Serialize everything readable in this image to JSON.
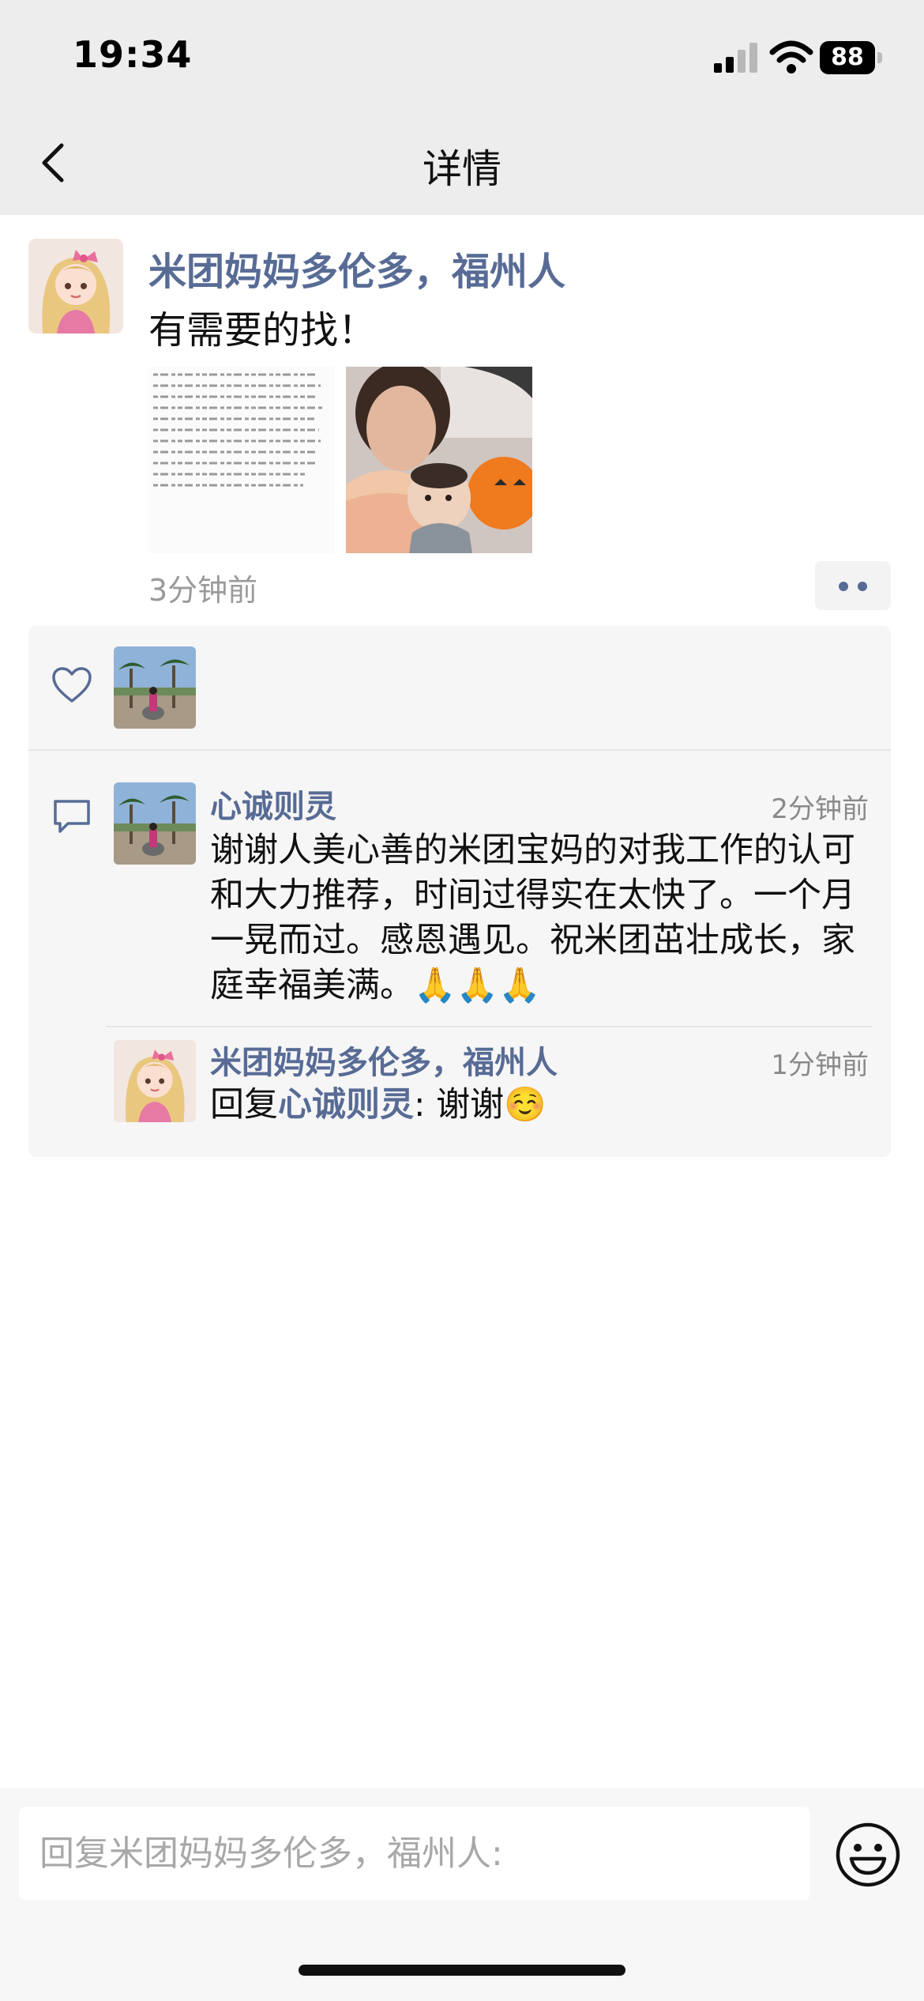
{
  "status_bar": {
    "time": "19:34",
    "battery": "88"
  },
  "nav": {
    "title": "详情"
  },
  "post": {
    "author": "米团妈妈多伦多，福州人",
    "text": "有需要的找！",
    "time": "3分钟前"
  },
  "comments": [
    {
      "author": "心诚则灵",
      "time": "2分钟前",
      "text": "谢谢人美心善的米团宝妈的对我工作的认可和大力推荐，时间过得实在太快了。一个月一晃而过。感恩遇见。祝米团茁壮成长，家庭幸福美满。🙏🙏🙏"
    },
    {
      "author": "米团妈妈多伦多，福州人",
      "time": "1分钟前",
      "reply_prefix": "回复",
      "reply_to": "心诚则灵",
      "separator": ": ",
      "text": "谢谢☺️"
    }
  ],
  "input": {
    "placeholder": "回复米团妈妈多伦多，福州人:"
  },
  "colors": {
    "link": "#576b95",
    "background": "#ededed"
  },
  "icons": [
    "back-arrow-icon",
    "signal-icon",
    "wifi-icon",
    "battery-icon",
    "heart-icon",
    "comment-icon",
    "more-icon",
    "emoji-icon"
  ]
}
